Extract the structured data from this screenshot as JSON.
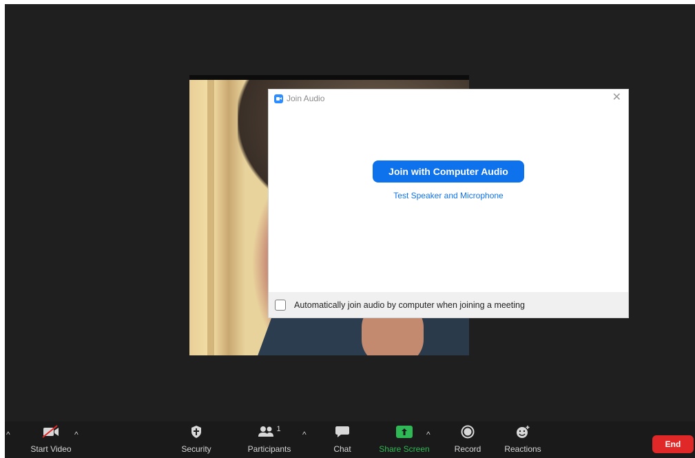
{
  "dialog": {
    "title": "Join Audio",
    "join_button": "Join with Computer Audio",
    "test_link": "Test Speaker and Microphone",
    "auto_join_label": "Automatically join audio by computer when joining a meeting",
    "auto_join_checked": false,
    "close_icon": "close-icon"
  },
  "toolbar": {
    "start_video": "Start Video",
    "security": "Security",
    "participants": "Participants",
    "participants_count": "1",
    "chat": "Chat",
    "share_screen": "Share Screen",
    "record": "Record",
    "reactions": "Reactions",
    "end": "End"
  },
  "colors": {
    "accent": "#0e72ed",
    "share_green": "#2fb855",
    "end_red": "#e02828",
    "window_bg": "#1f1f1f"
  }
}
